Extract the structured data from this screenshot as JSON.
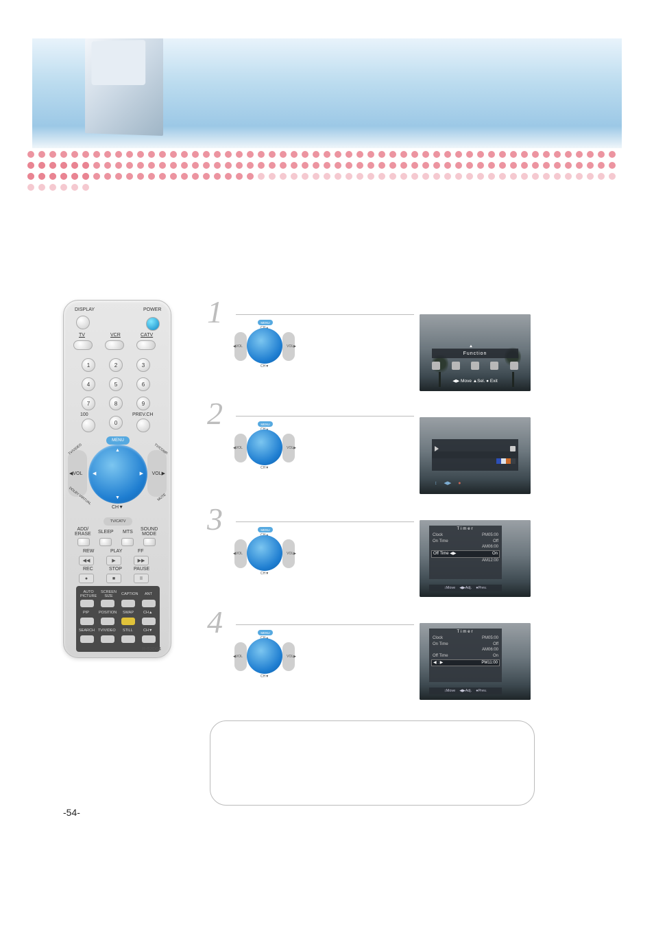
{
  "header": {
    "title": ""
  },
  "remote": {
    "labels": {
      "display": "DISPLAY",
      "power": "POWER",
      "tv": "TV",
      "vcr": "VCR",
      "catv": "CATV",
      "hundred": "100",
      "prevch": "PREV.CH",
      "menu": "MENU",
      "cha": "CH▲",
      "chv": "CH▼",
      "voll": "◀VOL",
      "volr": "VOL▶",
      "tvvideo_wing": "TV/VIDEO",
      "tvcomp_wing": "TV/COMP.",
      "dolby_wing": "DOLBY VIRTUAL",
      "mute_wing": "MUTE",
      "tvcatv": "TV/CATV",
      "row1": [
        "ADD/\nERASE",
        "SLEEP",
        "MTS",
        "SOUND\nMODE"
      ],
      "vcr_row1": [
        "REW",
        "PLAY",
        "FF"
      ],
      "vcr_row2": [
        "REC",
        "STOP",
        "PAUSE"
      ],
      "vcr_sym": [
        "◀◀",
        "▶",
        "▶▶",
        "●",
        "■",
        "II"
      ],
      "bb_row1": [
        "AUTO\nPICTURE",
        "SCREEN\nSIZE",
        "CAPTION",
        "ANT"
      ],
      "bb_row2": [
        "PIP",
        "POSITION",
        "SWAP",
        "CH▲"
      ],
      "bb_row3": [
        "SEARCH",
        "TV/VIDEO",
        "STILL",
        "CH▼"
      ]
    },
    "numbers": [
      "1",
      "2",
      "3",
      "4",
      "5",
      "6",
      "7",
      "8",
      "9",
      "0"
    ],
    "model": "R-52D04"
  },
  "steps": {
    "nums": [
      "1",
      "2",
      "3",
      "4"
    ],
    "cap": {
      "menu": "MENU",
      "cha": "CH▲",
      "chv": "CH▼",
      "voll": "◀VOL",
      "volr": "VOL▶"
    }
  },
  "shots": {
    "s1": {
      "title": "Function",
      "footer": "◀▶ Move ▲Sel. ● Exit"
    },
    "s2": {
      "footer_symbols": [
        "↕",
        "◀▶",
        "●"
      ]
    },
    "s3": {
      "title": "Timer",
      "rows": [
        {
          "label": "Clock",
          "value": "PM05:00"
        },
        {
          "label": "On Time",
          "value": "Off"
        },
        {
          "label": "",
          "value": "AM06:00"
        },
        {
          "label": "Off Time ◀▶",
          "value": "On",
          "selected": true
        },
        {
          "label": "",
          "value": "AM12:00"
        }
      ],
      "footer": [
        "↕Move",
        "◀▶Adj.",
        "●Prev."
      ]
    },
    "s4": {
      "title": "Timer",
      "rows": [
        {
          "label": "Clock",
          "value": "PM05:00"
        },
        {
          "label": "On Time",
          "value": "Off"
        },
        {
          "label": "",
          "value": "AM06:00"
        },
        {
          "label": "Off Time",
          "value": "On"
        },
        {
          "label": "◀ : ▶",
          "value": "PM11:00",
          "selected": true
        }
      ],
      "footer": [
        "↕Move",
        "◀▶Adj.",
        "●Prev."
      ]
    }
  },
  "pageNumber": "-54-"
}
